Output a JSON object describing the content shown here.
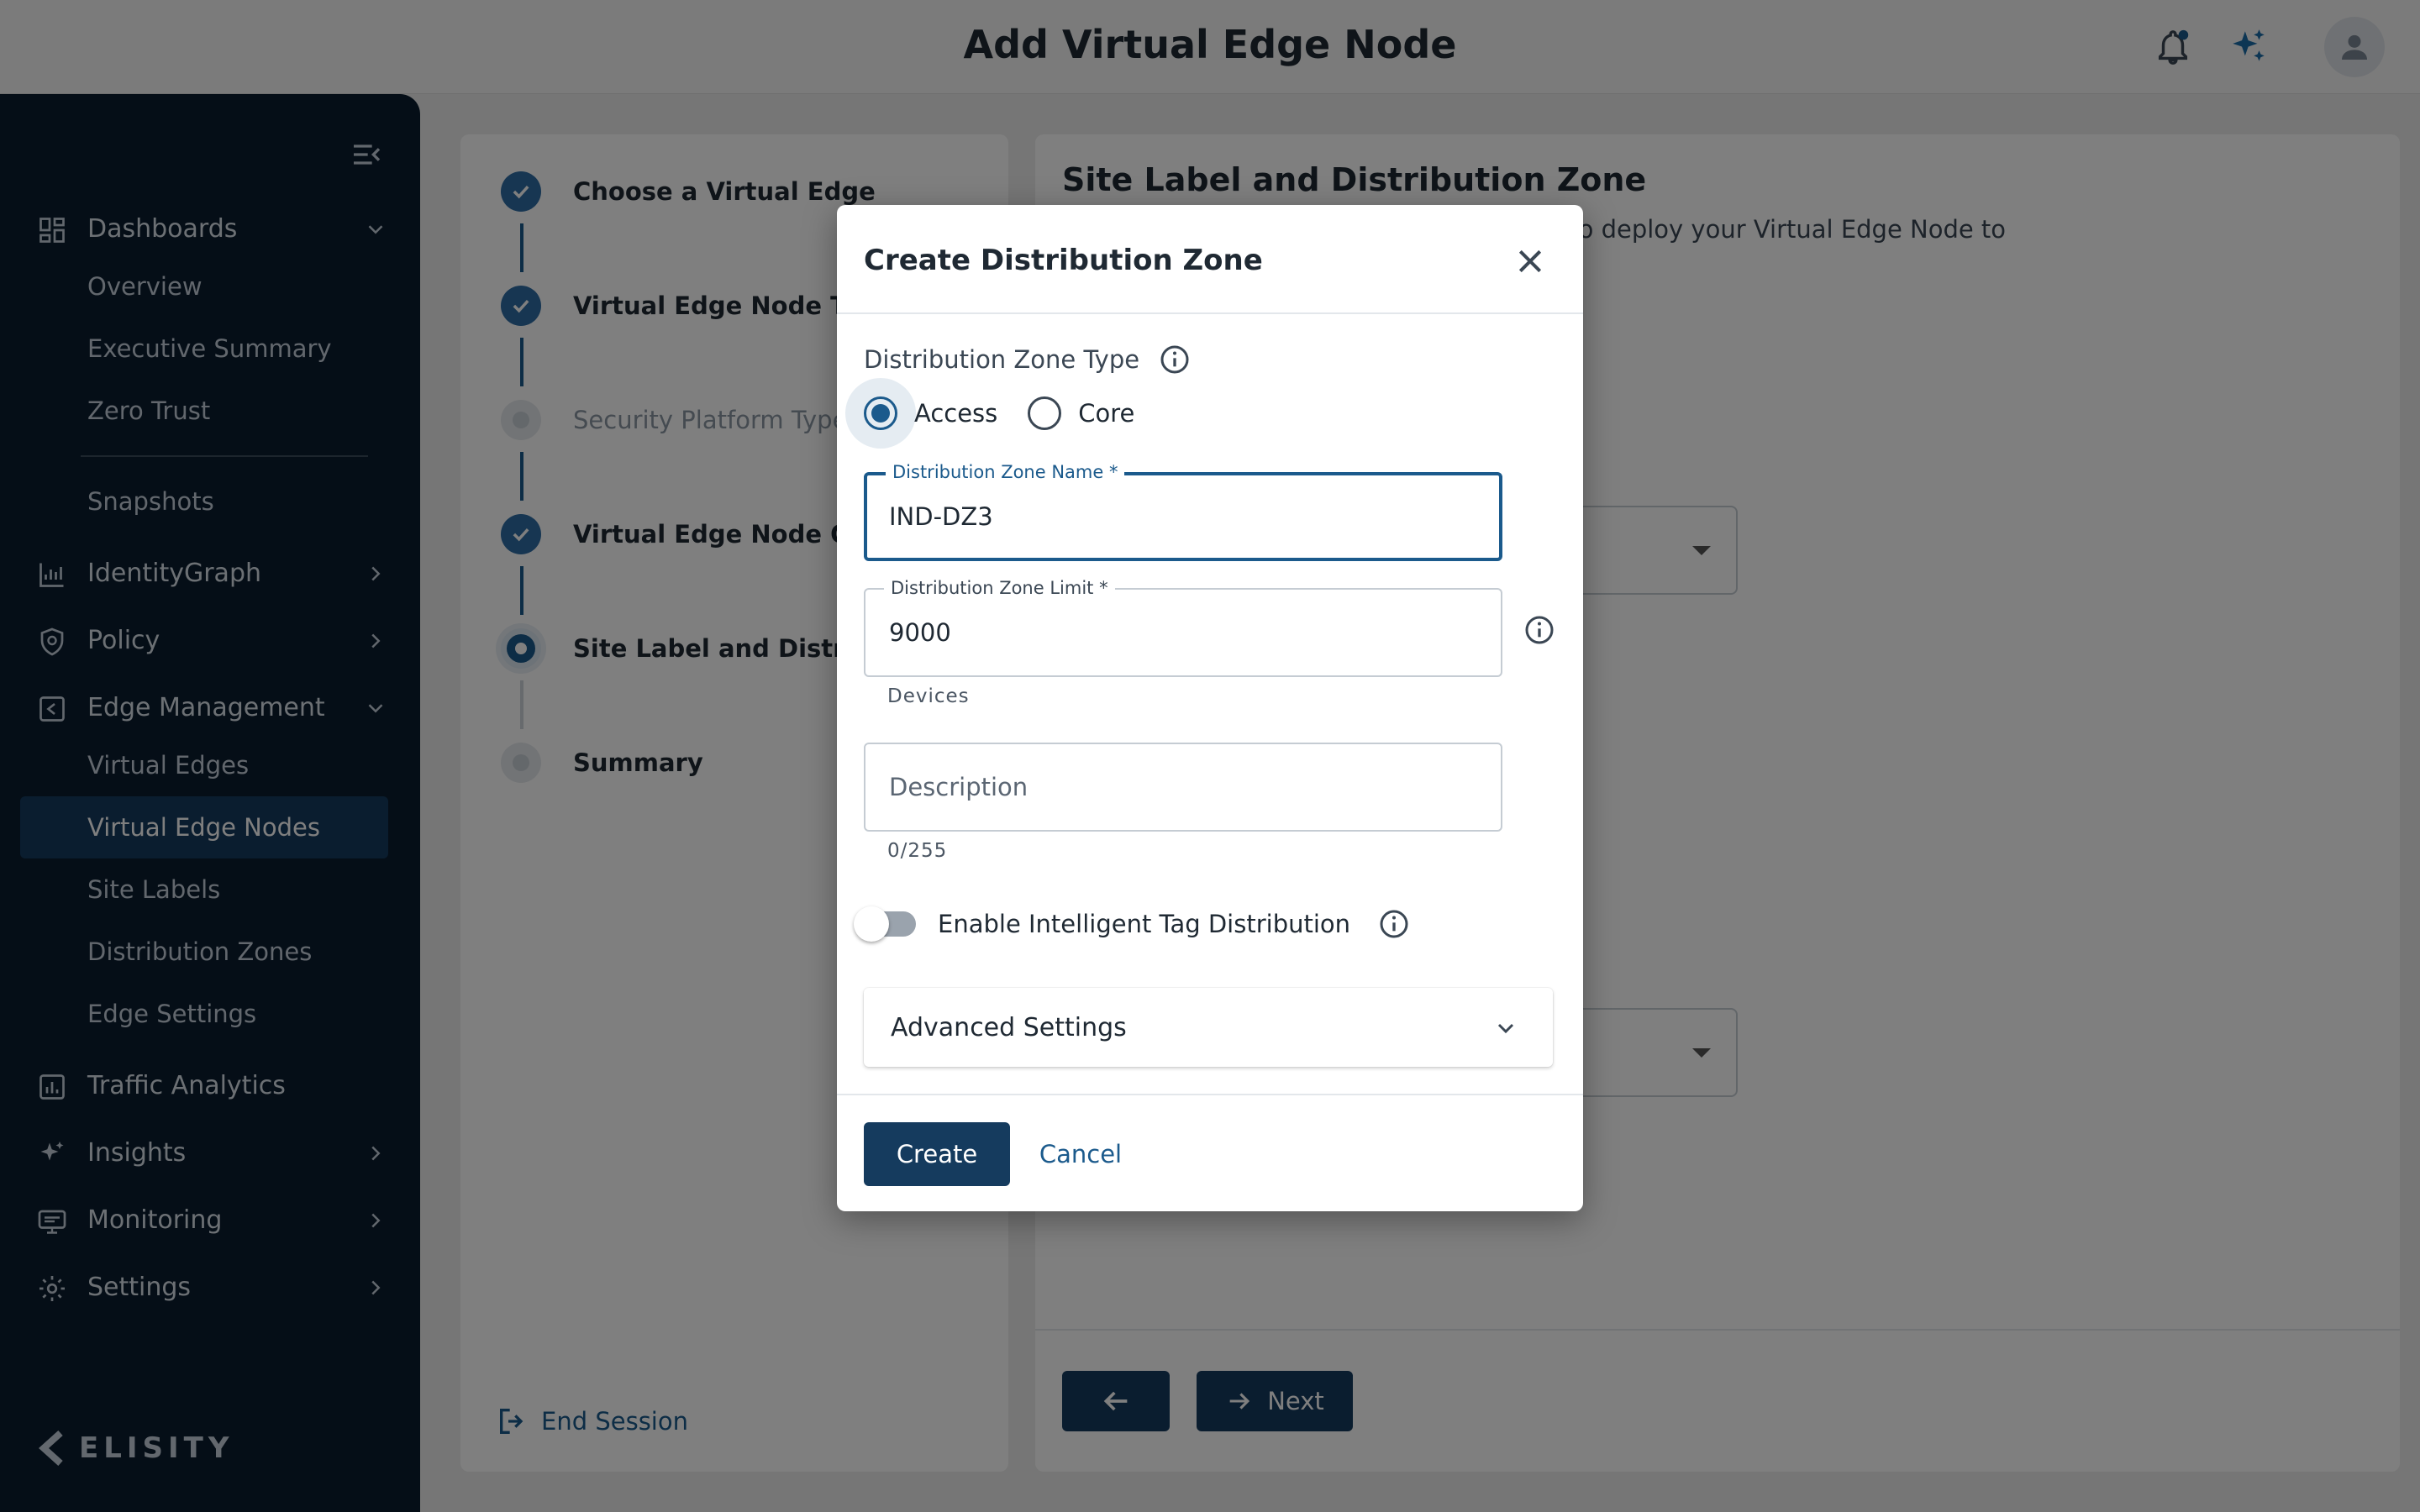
{
  "header": {
    "title": "Add Virtual Edge Node",
    "notification_icon": "bell-icon",
    "ai_icon": "sparkle-icon",
    "avatar_icon": "person-icon"
  },
  "sidebar": {
    "collapse_icon": "menu-collapse-icon",
    "sections": [
      {
        "label": "Dashboards",
        "icon": "grid-icon",
        "expanded": true
      },
      {
        "label": "IdentityGraph",
        "icon": "graph-icon",
        "expanded": false
      },
      {
        "label": "Policy",
        "icon": "shield-icon",
        "expanded": false
      },
      {
        "label": "Edge Management",
        "icon": "edge-icon",
        "expanded": true
      },
      {
        "label": "Traffic Analytics",
        "icon": "bar-chart-icon",
        "expanded": false
      },
      {
        "label": "Insights",
        "icon": "sparkle-icon",
        "expanded": false
      },
      {
        "label": "Monitoring",
        "icon": "monitor-icon",
        "expanded": false
      },
      {
        "label": "Settings",
        "icon": "gear-icon",
        "expanded": false
      }
    ],
    "dashboards_items": [
      "Overview",
      "Executive Summary",
      "Zero Trust",
      "Snapshots"
    ],
    "edge_items": [
      "Virtual Edges",
      "Virtual Edge Nodes",
      "Site Labels",
      "Distribution Zones",
      "Edge Settings"
    ],
    "active_item": "Virtual Edge Nodes",
    "brand": "ELISITY"
  },
  "stepper": {
    "steps": [
      {
        "label": "Choose a Virtual Edge",
        "state": "done"
      },
      {
        "label": "Virtual Edge Node Type",
        "state": "done"
      },
      {
        "label": "Security Platform Type",
        "state": "skipped"
      },
      {
        "label": "Virtual Edge Node Configuration",
        "state": "done"
      },
      {
        "label": "Site Label and Distribution Zone",
        "state": "current"
      },
      {
        "label": "Summary",
        "state": "pending"
      }
    ],
    "end_session_label": "End Session"
  },
  "main": {
    "title": "Site Label and Distribution Zone",
    "description": "Select a Site Label and Distribution Zone to deploy your Virtual Edge Node to",
    "back_icon": "arrow-left-icon",
    "next_label": "Next"
  },
  "dialog": {
    "title": "Create Distribution Zone",
    "zone_type_label": "Distribution Zone Type",
    "zone_type_options": [
      "Access",
      "Core"
    ],
    "zone_type_selected": "Access",
    "name_field": {
      "label": "Distribution Zone Name *",
      "value": "IND-DZ3"
    },
    "limit_field": {
      "label": "Distribution Zone Limit *",
      "value": "9000",
      "helper": "Devices"
    },
    "description_field": {
      "placeholder": "Description",
      "value": "",
      "counter": "0/255"
    },
    "toggle_label": "Enable Intelligent Tag Distribution",
    "toggle_on": false,
    "advanced_label": "Advanced Settings",
    "create_label": "Create",
    "cancel_label": "Cancel"
  },
  "colors": {
    "primary": "#153b5e",
    "accent": "#1b5a8c",
    "sidebar_bg": "#0a1d2f"
  }
}
